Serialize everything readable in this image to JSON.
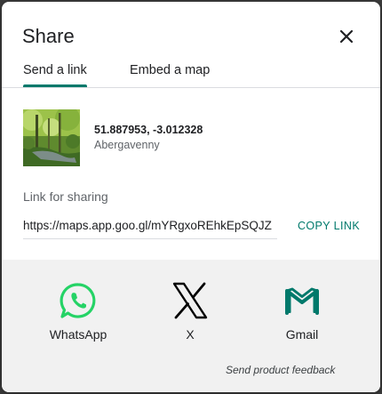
{
  "dialog": {
    "title": "Share",
    "close_icon": "close-icon"
  },
  "tabs": [
    {
      "label": "Send a link",
      "active": true
    },
    {
      "label": "Embed a map",
      "active": false
    }
  ],
  "location": {
    "coordinates": "51.887953, -3.012328",
    "place": "Abergavenny"
  },
  "link": {
    "label": "Link for sharing",
    "url": "https://maps.app.goo.gl/mYRgxoREhkEpSQJZ",
    "copy_label": "COPY LINK"
  },
  "share_targets": [
    {
      "label": "WhatsApp",
      "icon": "whatsapp-icon",
      "color": "#25d366"
    },
    {
      "label": "X",
      "icon": "x-logo-icon",
      "color": "#000000"
    },
    {
      "label": "Gmail",
      "icon": "gmail-icon",
      "color": "#00796b"
    }
  ],
  "feedback": "Send product feedback",
  "colors": {
    "accent": "#00796b",
    "share_background": "#f1f1f1"
  }
}
